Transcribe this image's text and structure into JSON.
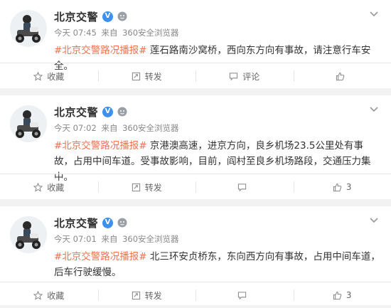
{
  "posts": [
    {
      "author": "北京交警",
      "verified": "V",
      "time": "今天 07:45",
      "source_prefix": "来自",
      "source": "360安全浏览器",
      "topic": "#北京交警路况播报#",
      "text": " 莲石路南沙窝桥，西向东方向有事故，请注意行车安全。",
      "actions": {
        "favorite": "收藏",
        "repost": "转发",
        "comment": "评论",
        "like": ""
      }
    },
    {
      "author": "北京交警",
      "verified": "V",
      "time": "今天 07:02",
      "source_prefix": "来自",
      "source": "360安全浏览器",
      "topic": "#北京交警路况播报#",
      "text": " 京港澳高速，进京方向，良乡机场23.5公里处有事故，占用中间车道。受事故影响，目前，阎村至良乡机场路段，交通压力集中。",
      "actions": {
        "favorite": "收藏",
        "repost": "转发",
        "comment": "",
        "like": "3"
      }
    },
    {
      "author": "北京交警",
      "verified": "V",
      "time": "今天 07:01",
      "source_prefix": "来自",
      "source": "360安全浏览器",
      "topic": "#北京交警路况播报#",
      "text": " 北三环安贞桥东，东向西方向有事故，占用中间车道，后车行驶缓慢。",
      "actions": {
        "favorite": "收藏",
        "repost": "转发",
        "comment": "",
        "like": "3"
      }
    }
  ],
  "colors": {
    "topic": "#eb7350",
    "verified": "#3d8ff0",
    "meta": "#888888"
  }
}
